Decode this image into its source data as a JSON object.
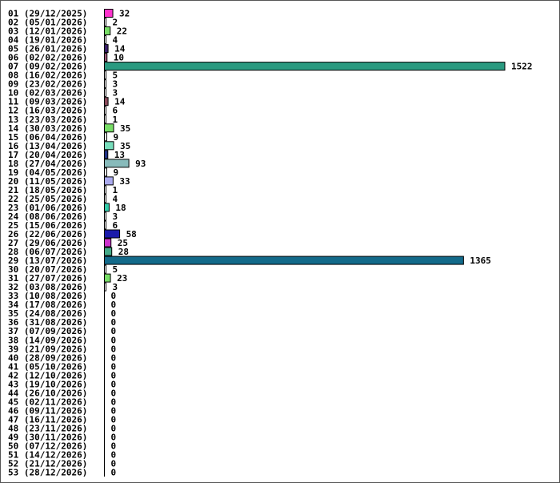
{
  "chart_data": {
    "type": "bar",
    "orientation": "horizontal",
    "title": "",
    "xlabel": "",
    "ylabel": "",
    "grid": false,
    "categories": [
      "01 (29/12/2025)",
      "02 (05/01/2026)",
      "03 (12/01/2026)",
      "04 (19/01/2026)",
      "05 (26/01/2026)",
      "06 (02/02/2026)",
      "07 (09/02/2026)",
      "08 (16/02/2026)",
      "09 (23/02/2026)",
      "10 (02/03/2026)",
      "11 (09/03/2026)",
      "12 (16/03/2026)",
      "13 (23/03/2026)",
      "14 (30/03/2026)",
      "15 (06/04/2026)",
      "16 (13/04/2026)",
      "17 (20/04/2026)",
      "18 (27/04/2026)",
      "19 (04/05/2026)",
      "20 (11/05/2026)",
      "21 (18/05/2026)",
      "22 (25/05/2026)",
      "23 (01/06/2026)",
      "24 (08/06/2026)",
      "25 (15/06/2026)",
      "26 (22/06/2026)",
      "27 (29/06/2026)",
      "28 (06/07/2026)",
      "29 (13/07/2026)",
      "30 (20/07/2026)",
      "31 (27/07/2026)",
      "32 (03/08/2026)",
      "33 (10/08/2026)",
      "34 (17/08/2026)",
      "35 (24/08/2026)",
      "36 (31/08/2026)",
      "37 (07/09/2026)",
      "38 (14/09/2026)",
      "39 (21/09/2026)",
      "40 (28/09/2026)",
      "41 (05/10/2026)",
      "42 (12/10/2026)",
      "43 (19/10/2026)",
      "44 (26/10/2026)",
      "45 (02/11/2026)",
      "46 (09/11/2026)",
      "47 (16/11/2026)",
      "48 (23/11/2026)",
      "49 (30/11/2026)",
      "50 (07/12/2026)",
      "51 (14/12/2026)",
      "52 (21/12/2026)",
      "53 (28/12/2026)"
    ],
    "values": [
      32,
      2,
      22,
      4,
      14,
      10,
      1522,
      5,
      3,
      3,
      14,
      6,
      1,
      35,
      9,
      35,
      13,
      93,
      9,
      33,
      1,
      4,
      18,
      3,
      6,
      58,
      25,
      28,
      1365,
      5,
      23,
      3,
      0,
      0,
      0,
      0,
      0,
      0,
      0,
      0,
      0,
      0,
      0,
      0,
      0,
      0,
      0,
      0,
      0,
      0,
      0,
      0,
      0
    ],
    "colors": [
      "#ff33cc",
      "#ffffff",
      "#77dd66",
      "#ffffff",
      "#3a1f6a",
      "#a05a7a",
      "#2a9a80",
      "#ffffff",
      "#ffffff",
      "#ffffff",
      "#8a4a5a",
      "#ffffff",
      "#ffffff",
      "#77dd66",
      "#ffffff",
      "#77ddbb",
      "#223388",
      "#88bbbb",
      "#ffffff",
      "#aaaaee",
      "#ffffff",
      "#ffffff",
      "#33ccaa",
      "#ffffff",
      "#ffffff",
      "#1a1aaa",
      "#cc33cc",
      "#44aa88",
      "#136a8a",
      "#ffffff",
      "#77dd66",
      "#ffffff",
      "#ffffff",
      "#ffffff",
      "#ffffff",
      "#ffffff",
      "#ffffff",
      "#ffffff",
      "#ffffff",
      "#ffffff",
      "#ffffff",
      "#ffffff",
      "#ffffff",
      "#ffffff",
      "#ffffff",
      "#ffffff",
      "#ffffff",
      "#ffffff",
      "#ffffff",
      "#ffffff",
      "#ffffff",
      "#ffffff",
      "#ffffff"
    ],
    "xlim": [
      0,
      1522
    ]
  }
}
